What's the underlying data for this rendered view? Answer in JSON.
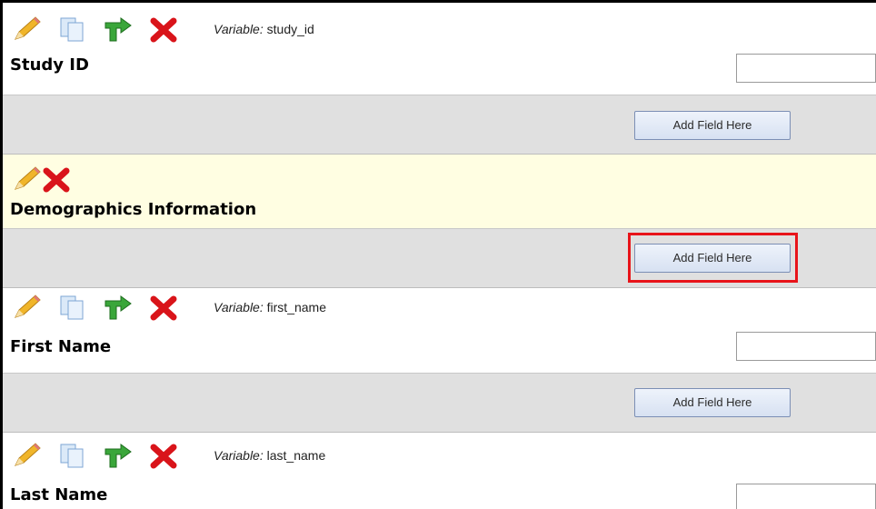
{
  "fields": [
    {
      "variable_label": "Variable:",
      "variable_name": "study_id",
      "label": "Study ID"
    },
    {
      "variable_label": "Variable:",
      "variable_name": "first_name",
      "label": "First Name"
    },
    {
      "variable_label": "Variable:",
      "variable_name": "last_name",
      "label": "Last Name"
    }
  ],
  "section_header": {
    "title": "Demographics Information"
  },
  "add_field_label": "Add Field Here",
  "icons": {
    "edit": "pencil-icon",
    "copy": "copy-icon",
    "move": "move-arrow-icon",
    "delete": "delete-x-icon"
  },
  "colors": {
    "header_bg": "#fffee2",
    "add_row_bg": "#e0e0e0",
    "highlight": "#e8141a"
  }
}
